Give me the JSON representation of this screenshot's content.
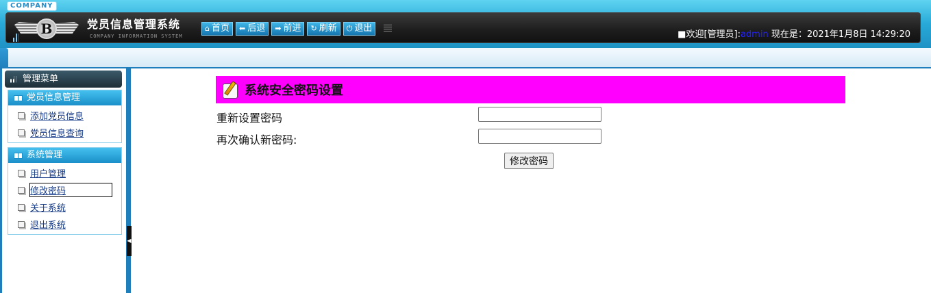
{
  "header": {
    "company_tag": "COMPANY",
    "app_title": "党员信息管理系统",
    "app_subtitle": "COMPANY INFORMATION SYSTEM",
    "logo_letter": "B",
    "nav": [
      {
        "label": "首页",
        "icon": "home-icon",
        "glyph": "⌂"
      },
      {
        "label": "后退",
        "icon": "back-arrow-icon",
        "glyph": "⬅"
      },
      {
        "label": "前进",
        "icon": "forward-arrow-icon",
        "glyph": "➡"
      },
      {
        "label": "刷新",
        "icon": "refresh-icon",
        "glyph": "↻"
      },
      {
        "label": "退出",
        "icon": "power-icon",
        "glyph": "⏻"
      }
    ],
    "welcome_prefix": "■欢迎[管理员]:",
    "username": "admin",
    "time_prefix": " 现在是：",
    "datetime": "2021年1月8日 14:29:20"
  },
  "sidebar": {
    "menu_title": "管理菜单",
    "groups": [
      {
        "title": "党员信息管理",
        "items": [
          "添加党员信息",
          "党员信息查询"
        ]
      },
      {
        "title": "系统管理",
        "items": [
          "用户管理",
          "修改密码",
          "关于系统",
          "退出系统"
        ]
      }
    ]
  },
  "form": {
    "title": "系统安全密码设置",
    "new_password_label": "重新设置密码",
    "new_password_value": "",
    "confirm_password_label": "再次确认新密码:",
    "confirm_password_value": "",
    "submit_label": "修改密码"
  },
  "colors": {
    "title_bar": "#ff00ff",
    "accent": "#1f7fbc",
    "link": "#1b3f8a"
  }
}
